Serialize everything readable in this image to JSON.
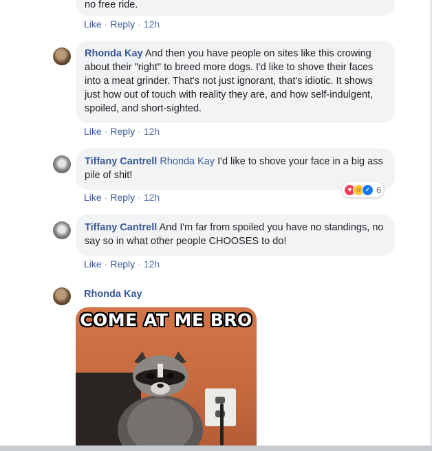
{
  "comments": [
    {
      "text": "no free ride.",
      "actions": {
        "like": "Like",
        "reply": "Reply",
        "time": "12h"
      }
    },
    {
      "author": "Rhonda Kay",
      "text": "And then you have people on sites like this crowing about their \"right\" to breed more dogs. I'd like to shove their faces into a meat grinder. That's not just ignorant, that's idiotic. It shows just how out of touch with reality they are, and how self-indulgent, spoiled, and short-sighted.",
      "actions": {
        "like": "Like",
        "reply": "Reply",
        "time": "12h"
      }
    },
    {
      "author": "Tiffany Cantrell",
      "mention": "Rhonda Kay",
      "text": "I'd like to shove your face in a big ass pile of shit!",
      "reactions": {
        "types": [
          "love",
          "haha",
          "like"
        ],
        "count": "6"
      },
      "actions": {
        "like": "Like",
        "reply": "Reply",
        "time": "12h"
      }
    },
    {
      "author": "Tiffany Cantrell",
      "text": "And I'm far from spoiled you have no standings, no say so in what other people CHOOSES to do!",
      "actions": {
        "like": "Like",
        "reply": "Reply",
        "time": "12h"
      }
    },
    {
      "author": "Rhonda Kay",
      "image": {
        "caption": "COME AT ME BRO",
        "subject": "raccoon"
      }
    }
  ],
  "colors": {
    "link": "#385898",
    "bubble": "#f2f3f5",
    "meta": "#8d949e"
  }
}
